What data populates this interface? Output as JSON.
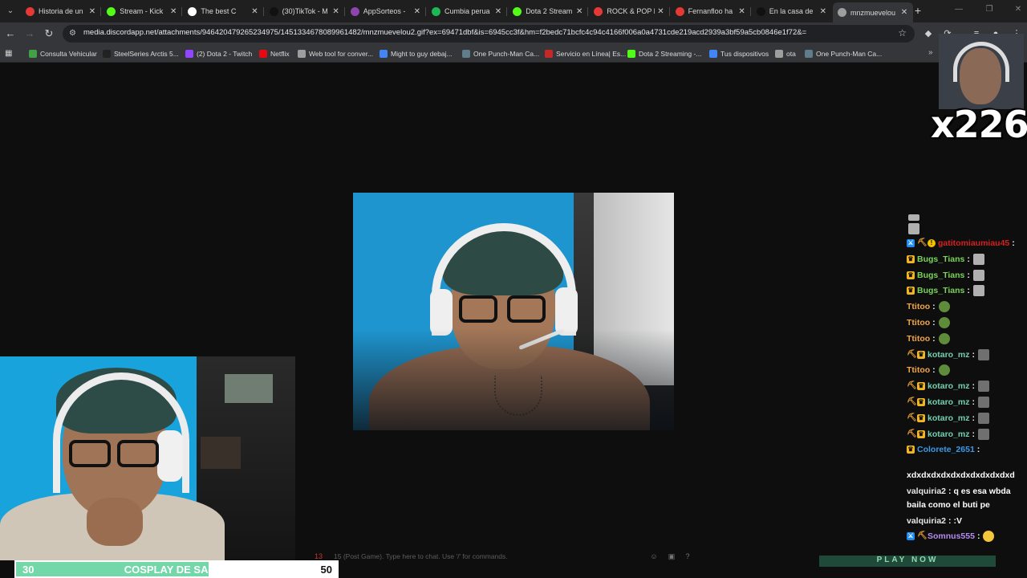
{
  "tabs": [
    {
      "label": "Historia de un",
      "color": "#e53935"
    },
    {
      "label": "Stream - Kick",
      "color": "#53fc18"
    },
    {
      "label": "The best C",
      "color": "#ffffff"
    },
    {
      "label": "(30)TikTok - M",
      "color": "#111111"
    },
    {
      "label": "AppSorteos -",
      "color": "#8e44ad"
    },
    {
      "label": "Cumbia perua",
      "color": "#1db954"
    },
    {
      "label": "Dota 2 Stream",
      "color": "#53fc18"
    },
    {
      "label": "ROCK & POP h",
      "color": "#e53935"
    },
    {
      "label": "Fernanfloo ha",
      "color": "#e53935"
    },
    {
      "label": "En la casa de",
      "color": "#111111"
    },
    {
      "label": "mnzmuevelou",
      "color": "#9e9e9e"
    }
  ],
  "tab_close": "✕",
  "new_tab": "+",
  "address_bar": {
    "url": "media.discordapp.net/attachments/946420479265234975/1451334678089961482/mnzmuevelou2.gif?ex=69471dbf&is=6945cc3f&hm=f2bedc71bcfc4c94c4166f006a0a4731cde219acd2939a3bf59a5cb0846e1f72&="
  },
  "bookmarks": [
    {
      "label": "Consulta Vehicular",
      "color": "#43a047"
    },
    {
      "label": "SteelSeries Arctis 5...",
      "color": "#222222"
    },
    {
      "label": "(2) Dota 2 - Twitch",
      "color": "#9146ff"
    },
    {
      "label": "Netflix",
      "color": "#e50914"
    },
    {
      "label": "Web tool for conver...",
      "color": "#9e9e9e"
    },
    {
      "label": "Might to guy debaj...",
      "color": "#4285f4"
    },
    {
      "label": "One Punch-Man Ca...",
      "color": "#607d8b"
    },
    {
      "label": "Servicio en Línea| Es...",
      "color": "#c62828"
    },
    {
      "label": "Dota 2 Streaming -...",
      "color": "#53fc18"
    },
    {
      "label": "Tus dispositivos",
      "color": "#4285f4"
    },
    {
      "label": "ota",
      "color": "#9e9e9e"
    },
    {
      "label": "One Punch-Man Ca...",
      "color": "#607d8b"
    }
  ],
  "hype": {
    "count": "x226"
  },
  "chat": {
    "lines": [
      {
        "name": "gatitomiaumiau45",
        "color": "#d42020",
        "text": ":",
        "badges": [
          "mod",
          "pick",
          "gift"
        ],
        "emote": ""
      },
      {
        "name": "Bugs_Tians",
        "color": "#7ad35b",
        "text": ":",
        "badges": [
          "crown"
        ],
        "emote": "gray2"
      },
      {
        "name": "Bugs_Tians",
        "color": "#7ad35b",
        "text": ":",
        "badges": [
          "crown"
        ],
        "emote": "gray2"
      },
      {
        "name": "Bugs_Tians",
        "color": "#7ad35b",
        "text": ":",
        "badges": [
          "crown"
        ],
        "emote": "gray2"
      },
      {
        "name": "Ttitoo",
        "color": "#f0a64a",
        "text": ":",
        "badges": [],
        "emote": "green"
      },
      {
        "name": "Ttitoo",
        "color": "#f0a64a",
        "text": ":",
        "badges": [],
        "emote": "green"
      },
      {
        "name": "Ttitoo",
        "color": "#f0a64a",
        "text": ":",
        "badges": [],
        "emote": "green"
      },
      {
        "name": "kotaro_mz",
        "color": "#72d0b0",
        "text": ":",
        "badges": [
          "pick",
          "crown"
        ],
        "emote": "gray"
      },
      {
        "name": "Ttitoo",
        "color": "#f0a64a",
        "text": ":",
        "badges": [],
        "emote": "green"
      },
      {
        "name": "kotaro_mz",
        "color": "#72d0b0",
        "text": ":",
        "badges": [
          "pick",
          "crown"
        ],
        "emote": "gray"
      },
      {
        "name": "kotaro_mz",
        "color": "#72d0b0",
        "text": ":",
        "badges": [
          "pick",
          "crown"
        ],
        "emote": "gray"
      },
      {
        "name": "kotaro_mz",
        "color": "#72d0b0",
        "text": ":",
        "badges": [
          "pick",
          "crown"
        ],
        "emote": "gray"
      },
      {
        "name": "kotaro_mz",
        "color": "#72d0b0",
        "text": ":",
        "badges": [
          "pick",
          "crown"
        ],
        "emote": "gray"
      },
      {
        "name": "Colorete_2651",
        "color": "#3d9ae8",
        "text": ":",
        "badges": [
          "crown"
        ],
        "emote": ""
      }
    ],
    "colorete_msg": "xdxdxdxdxdxdxdxdxdxdxd",
    "valquiria_line1": {
      "name": "valquiria2",
      "color": "#e8e8e8",
      "text": ": q es esa wbda"
    },
    "valquiria_cont": "baila como el buti pe",
    "valquiria_line2": {
      "name": "valquiria2",
      "color": "#e8e8e8",
      "text": ": :V"
    },
    "somnus": {
      "name": "Somnus555",
      "color": "#b48cf0",
      "text": ":"
    }
  },
  "chat_input": {
    "tag": "13",
    "hint": "15 (Post Game).  Type here to chat.  Use '/' for commands."
  },
  "play_button": "PLAY NOW",
  "goal": {
    "current": "30",
    "title": "COSPLAY DE SANTA",
    "target": "50",
    "progress": 0.6,
    "fill_color": "#74d7a9"
  }
}
